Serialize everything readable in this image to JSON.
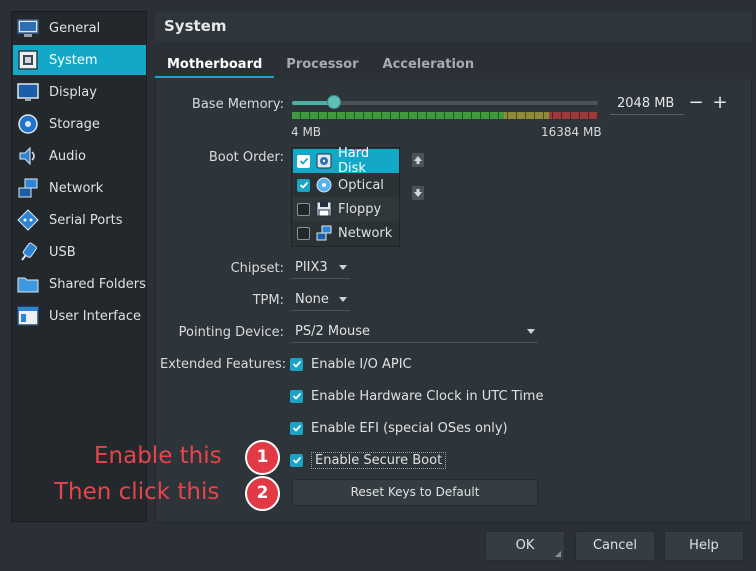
{
  "sidebar": {
    "items": [
      {
        "label": "General",
        "icon": "monitor-icon"
      },
      {
        "label": "System",
        "icon": "chip-board-icon",
        "active": true
      },
      {
        "label": "Display",
        "icon": "display-icon"
      },
      {
        "label": "Storage",
        "icon": "disk-icon"
      },
      {
        "label": "Audio",
        "icon": "speaker-icon"
      },
      {
        "label": "Network",
        "icon": "network-icon"
      },
      {
        "label": "Serial Ports",
        "icon": "serial-port-icon"
      },
      {
        "label": "USB",
        "icon": "usb-icon"
      },
      {
        "label": "Shared Folders",
        "icon": "folder-icon"
      },
      {
        "label": "User Interface",
        "icon": "window-icon"
      }
    ]
  },
  "header": {
    "title": "System"
  },
  "tabs": [
    {
      "label": "Motherboard",
      "active": true
    },
    {
      "label": "Processor"
    },
    {
      "label": "Acceleration"
    }
  ],
  "motherboard": {
    "base_memory": {
      "label": "Base Memory:",
      "min_label": "4 MB",
      "max_label": "16384 MB",
      "value_text": "2048 MB",
      "value_fraction": 0.125,
      "decrease": "−",
      "increase": "+"
    },
    "boot_order": {
      "label": "Boot Order:",
      "items": [
        {
          "label": "Hard Disk",
          "checked": true,
          "selected": true,
          "icon": "hard-disk-icon"
        },
        {
          "label": "Optical",
          "checked": true,
          "icon": "optical-disc-icon"
        },
        {
          "label": "Floppy",
          "checked": false,
          "icon": "floppy-icon"
        },
        {
          "label": "Network",
          "checked": false,
          "icon": "network-icon"
        }
      ]
    },
    "chipset": {
      "label": "Chipset:",
      "value": "PIIX3"
    },
    "tpm": {
      "label": "TPM:",
      "value": "None"
    },
    "pointing_device": {
      "label": "Pointing Device:",
      "value": "PS/2 Mouse"
    },
    "extended_features": {
      "label": "Extended Features:",
      "options": [
        {
          "label": "Enable I/O APIC",
          "checked": true
        },
        {
          "label": "Enable Hardware Clock in UTC Time",
          "checked": true
        },
        {
          "label": "Enable EFI (special OSes only)",
          "checked": true
        },
        {
          "label": "Enable Secure Boot",
          "checked": true
        }
      ]
    },
    "reset_keys_button": "Reset Keys to Default"
  },
  "annotations": [
    {
      "text": "Enable this",
      "badge": "1"
    },
    {
      "text": "Then click this",
      "badge": "2"
    }
  ],
  "footer": {
    "ok": "OK",
    "cancel": "Cancel",
    "help": "Help"
  },
  "colors": {
    "accent": "#14a8c8",
    "annotation": "#e23a44"
  }
}
